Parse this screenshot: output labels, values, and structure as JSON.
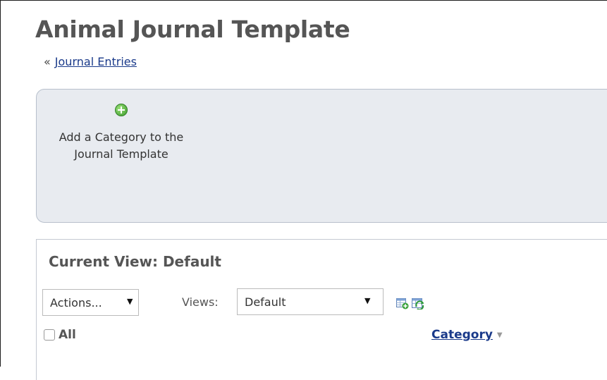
{
  "page": {
    "title": "Animal Journal Template",
    "breadcrumb_arrow": "«",
    "breadcrumb_link": "Journal Entries"
  },
  "action_panel": {
    "add_category_label": "Add a Category to the Journal Template",
    "add_icon": "plus-circle-icon"
  },
  "view": {
    "title": "Current View: Default",
    "actions_label": "Actions...",
    "views_label": "Views:",
    "views_selected": "Default",
    "caret_glyph": "▼",
    "icons": [
      "add-grid-icon",
      "refresh-grid-icon"
    ]
  },
  "table": {
    "select_all_label": "All",
    "columns": [
      "Category"
    ],
    "sort_glyph": "▼"
  },
  "colors": {
    "link": "#1a3a8a",
    "panel_bg": "#e8ebf0",
    "panel_border": "#b8c0cc",
    "title_text": "#555555",
    "add_icon": "#3a9a2a"
  }
}
